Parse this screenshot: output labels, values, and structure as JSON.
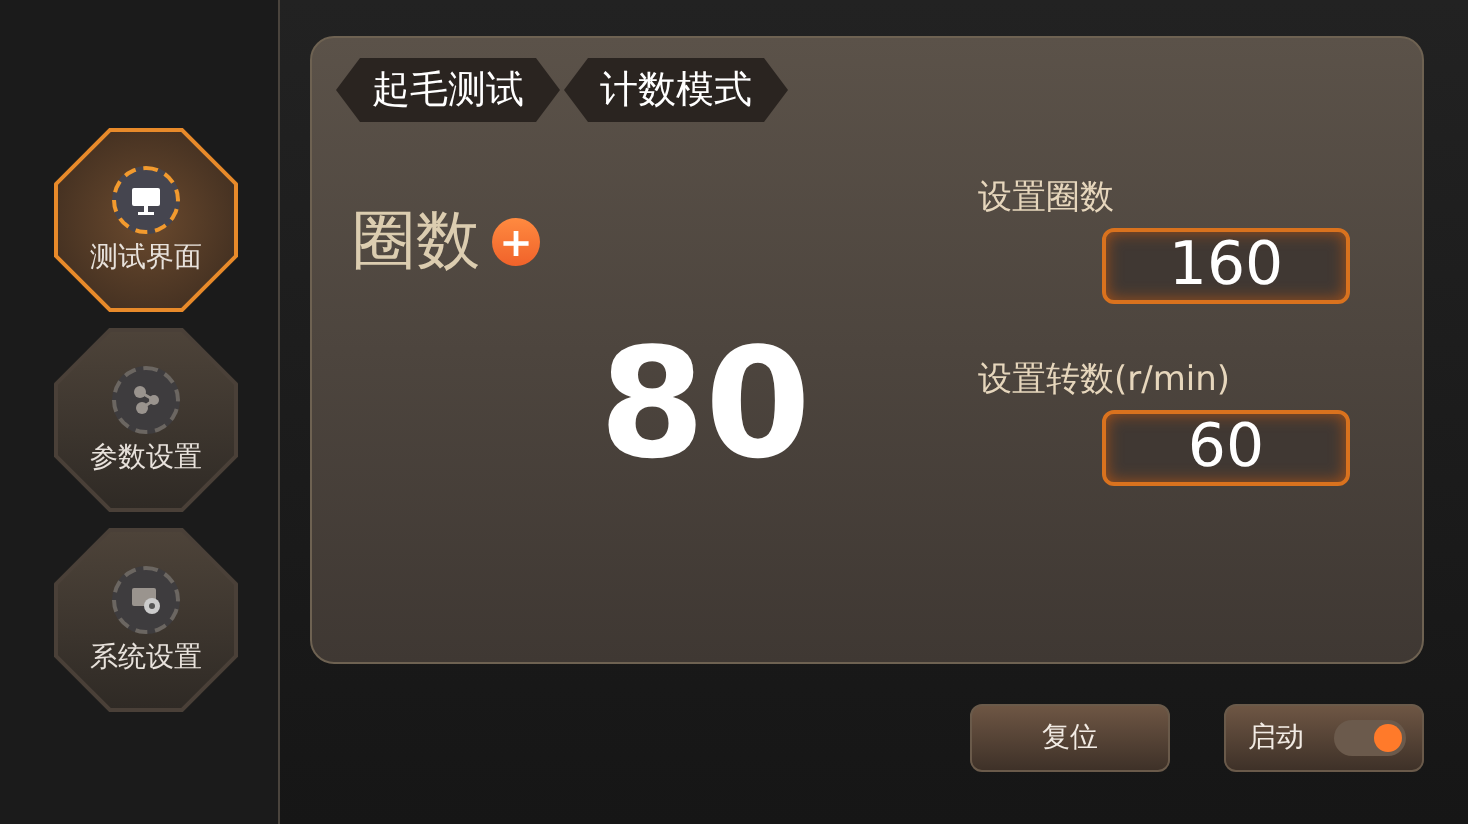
{
  "sidebar": {
    "items": [
      {
        "label": "测试界面",
        "selected": true
      },
      {
        "label": "参数设置",
        "selected": false
      },
      {
        "label": "系统设置",
        "selected": false
      }
    ]
  },
  "breadcrumbs": [
    "起毛测试",
    "计数模式"
  ],
  "counter": {
    "label": "圈数",
    "add_symbol": "+",
    "value": "80"
  },
  "settings": [
    {
      "label": "设置圈数",
      "value": "160"
    },
    {
      "label": "设置转数(r/min)",
      "value": "60"
    }
  ],
  "reset_button": "复位",
  "start": {
    "label": "启动",
    "on": true
  }
}
